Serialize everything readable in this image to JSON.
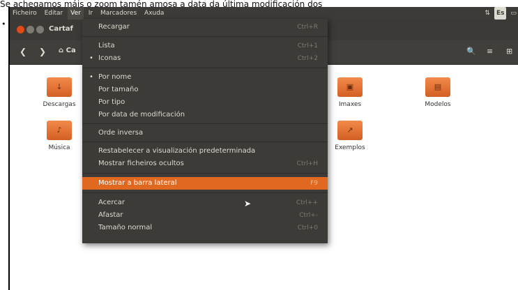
{
  "caption": {
    "text": "Se achegamos máis o zoom tamén amosa a data da última modificación dos",
    "bullet": "•"
  },
  "menubar": {
    "items": [
      "Ficheiro",
      "Editar",
      "Ver",
      "Ir",
      "Marcadores",
      "Axuda"
    ],
    "active_index": 2,
    "indicators": {
      "network": "⇅",
      "keyboard": "Es",
      "battery": "▭"
    }
  },
  "window": {
    "title": "Cartaf",
    "breadcrumb": "Ca"
  },
  "toolbar": {
    "back": "❮",
    "forward": "❯",
    "home_icon": "⌂",
    "search": "🔍",
    "menu": "≡",
    "extra": "⊞"
  },
  "folders": [
    {
      "name": "Descargas",
      "glyph": "↓"
    },
    {
      "name": "Imaxes",
      "glyph": "▣"
    },
    {
      "name": "Modelos",
      "glyph": "▤"
    },
    {
      "name": "Música",
      "glyph": "♪"
    },
    {
      "name": "Exemplos",
      "glyph": "↗"
    }
  ],
  "view_menu": {
    "items": [
      {
        "label": "Recargar",
        "accel": "Ctrl+R"
      },
      {
        "label": "Lista",
        "accel": "Ctrl+1"
      },
      {
        "label": "Iconas",
        "accel": "Ctrl+2",
        "checked": true
      },
      {
        "label": "Por nome",
        "accel": "",
        "checked": true
      },
      {
        "label": "Por tamaño",
        "accel": ""
      },
      {
        "label": "Por tipo",
        "accel": ""
      },
      {
        "label": "Por data de modificación",
        "accel": ""
      },
      {
        "label": "Orde inversa",
        "accel": ""
      },
      {
        "label": "Restabelecer a visualización predeterminada",
        "accel": ""
      },
      {
        "label": "Mostrar ficheiros ocultos",
        "accel": "Ctrl+H"
      },
      {
        "label": "Mostrar a barra lateral",
        "accel": "F9",
        "highlighted": true
      },
      {
        "label": "Acercar",
        "accel": "Ctrl++"
      },
      {
        "label": "Afastar",
        "accel": "Ctrl+-"
      },
      {
        "label": "Tamaño normal",
        "accel": "Ctrl+0"
      }
    ]
  }
}
